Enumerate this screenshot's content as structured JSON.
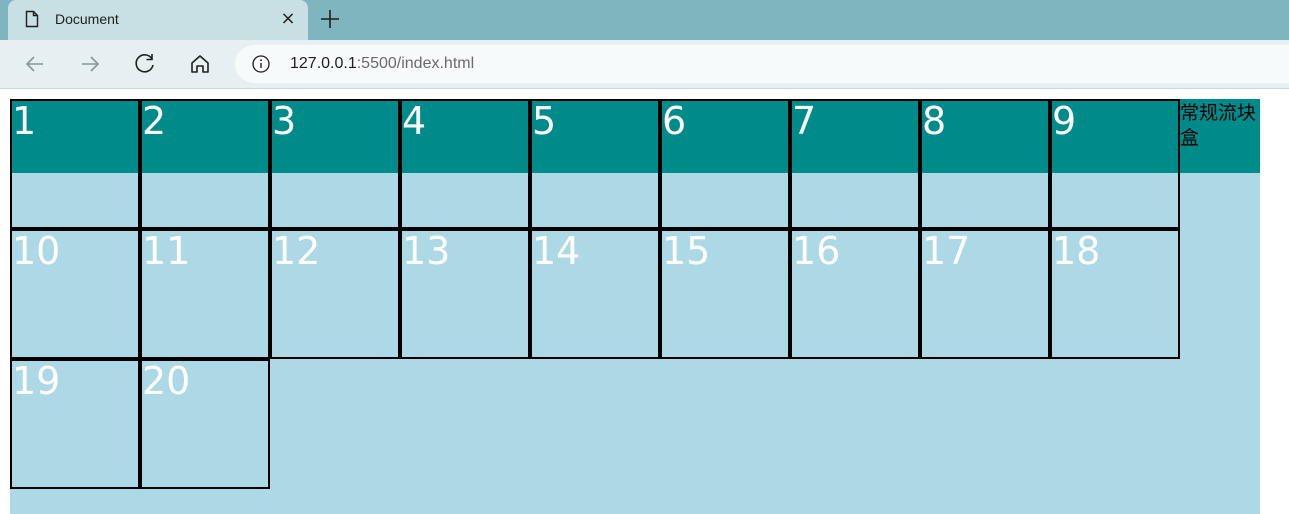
{
  "browser": {
    "tab_title": "Document",
    "tab_close_glyph": "×",
    "address_host": "127.0.0.1",
    "address_rest": ":5500/index.html",
    "icons": {
      "tab": "document-icon",
      "close": "close-icon",
      "new_tab": "plus-icon",
      "back": "back-arrow-icon",
      "forward": "forward-arrow-icon",
      "reload": "reload-icon",
      "home": "home-icon",
      "info": "info-icon"
    }
  },
  "page": {
    "colors": {
      "container": "#add8e6",
      "band": "#008b8b",
      "box_text": "#ffffff",
      "border": "#000000"
    },
    "boxes": [
      "1",
      "2",
      "3",
      "4",
      "5",
      "6",
      "7",
      "8",
      "9",
      "10",
      "11",
      "12",
      "13",
      "14",
      "15",
      "16",
      "17",
      "18",
      "19",
      "20"
    ],
    "flow_box_text": "常规流块盒"
  }
}
